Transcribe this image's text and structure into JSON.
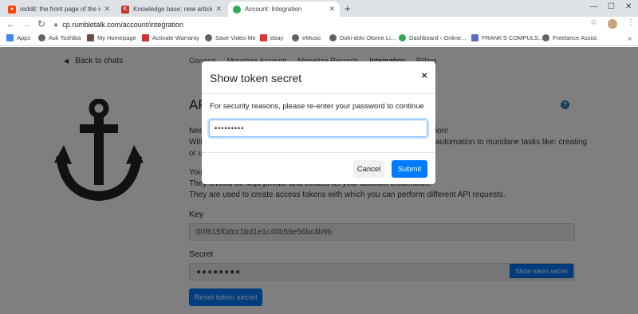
{
  "browser": {
    "tabs": [
      {
        "title": "reddit: the front page of the inte",
        "icon": "reddit-icon",
        "color": "#ff4500"
      },
      {
        "title": "Knowledge base: new article diffi",
        "icon": "knowledge-base-icon",
        "color": "#c0392b"
      },
      {
        "title": "Account: Integration",
        "icon": "chat-bubble-icon",
        "color": "#34a853"
      }
    ],
    "url": "cp.rumbletalk.com/account/integration",
    "bookmarks": [
      {
        "label": "Apps",
        "icon": "apps-grid-icon",
        "color": "#4285f4"
      },
      {
        "label": "Ask Toshiba",
        "icon": "globe-icon",
        "color": "#5f6368"
      },
      {
        "label": "My Homepage",
        "icon": "page-icon",
        "color": "#6d4c41"
      },
      {
        "label": "Activate Warranty",
        "icon": "toshiba-icon",
        "color": "#d32f2f"
      },
      {
        "label": "Save Video Me",
        "icon": "globe-icon",
        "color": "#5f6368"
      },
      {
        "label": "ebay",
        "icon": "ebay-icon",
        "color": "#e53238"
      },
      {
        "label": "eMusic",
        "icon": "globe-icon",
        "color": "#5f6368"
      },
      {
        "label": "Doki-doki Otome Li...",
        "icon": "globe-icon",
        "color": "#5f6368"
      },
      {
        "label": "Dashboard ‹ Online...",
        "icon": "chat-bubble-icon",
        "color": "#34a853"
      },
      {
        "label": "FRANK'S COMPULS...",
        "icon": "bookmark-icon",
        "color": "#5c6bc0"
      },
      {
        "label": "Freelance Assist",
        "icon": "globe-icon",
        "color": "#5f6368"
      }
    ]
  },
  "page": {
    "back_label": "Back to chats",
    "subnav": [
      "General",
      "Monetize Account",
      "Monetize Records",
      "Integration",
      "Billing"
    ],
    "heading": "API",
    "desc_line1": "Nee",
    "desc_line1_end": "ion!",
    "desc_line2": "With",
    "desc_line2_end": "automation to mundane tasks like: creating",
    "desc_line3": "or u",
    "desc_line4": "Your",
    "desc_line5": "They should be kept private and treated as your account credentials.",
    "desc_line6": "They are used to create access tokens with which you can perform different API requests.",
    "key_label": "Key",
    "key_value": "00f615f0dcc1bd1e1c40b56e56bc4b9b",
    "secret_label": "Secret",
    "secret_value": "●●●●●●●●",
    "show_secret_button": "Show token secret",
    "reset_secret_button": "Reset token secret"
  },
  "modal": {
    "title": "Show token secret",
    "close": "×",
    "message": "For security reasons, please re-enter your password to continue",
    "password_value": "•••••••••",
    "cancel_label": "Cancel",
    "submit_label": "Submit"
  },
  "colors": {
    "primary": "#007bff",
    "help": "#2b7cb6"
  }
}
